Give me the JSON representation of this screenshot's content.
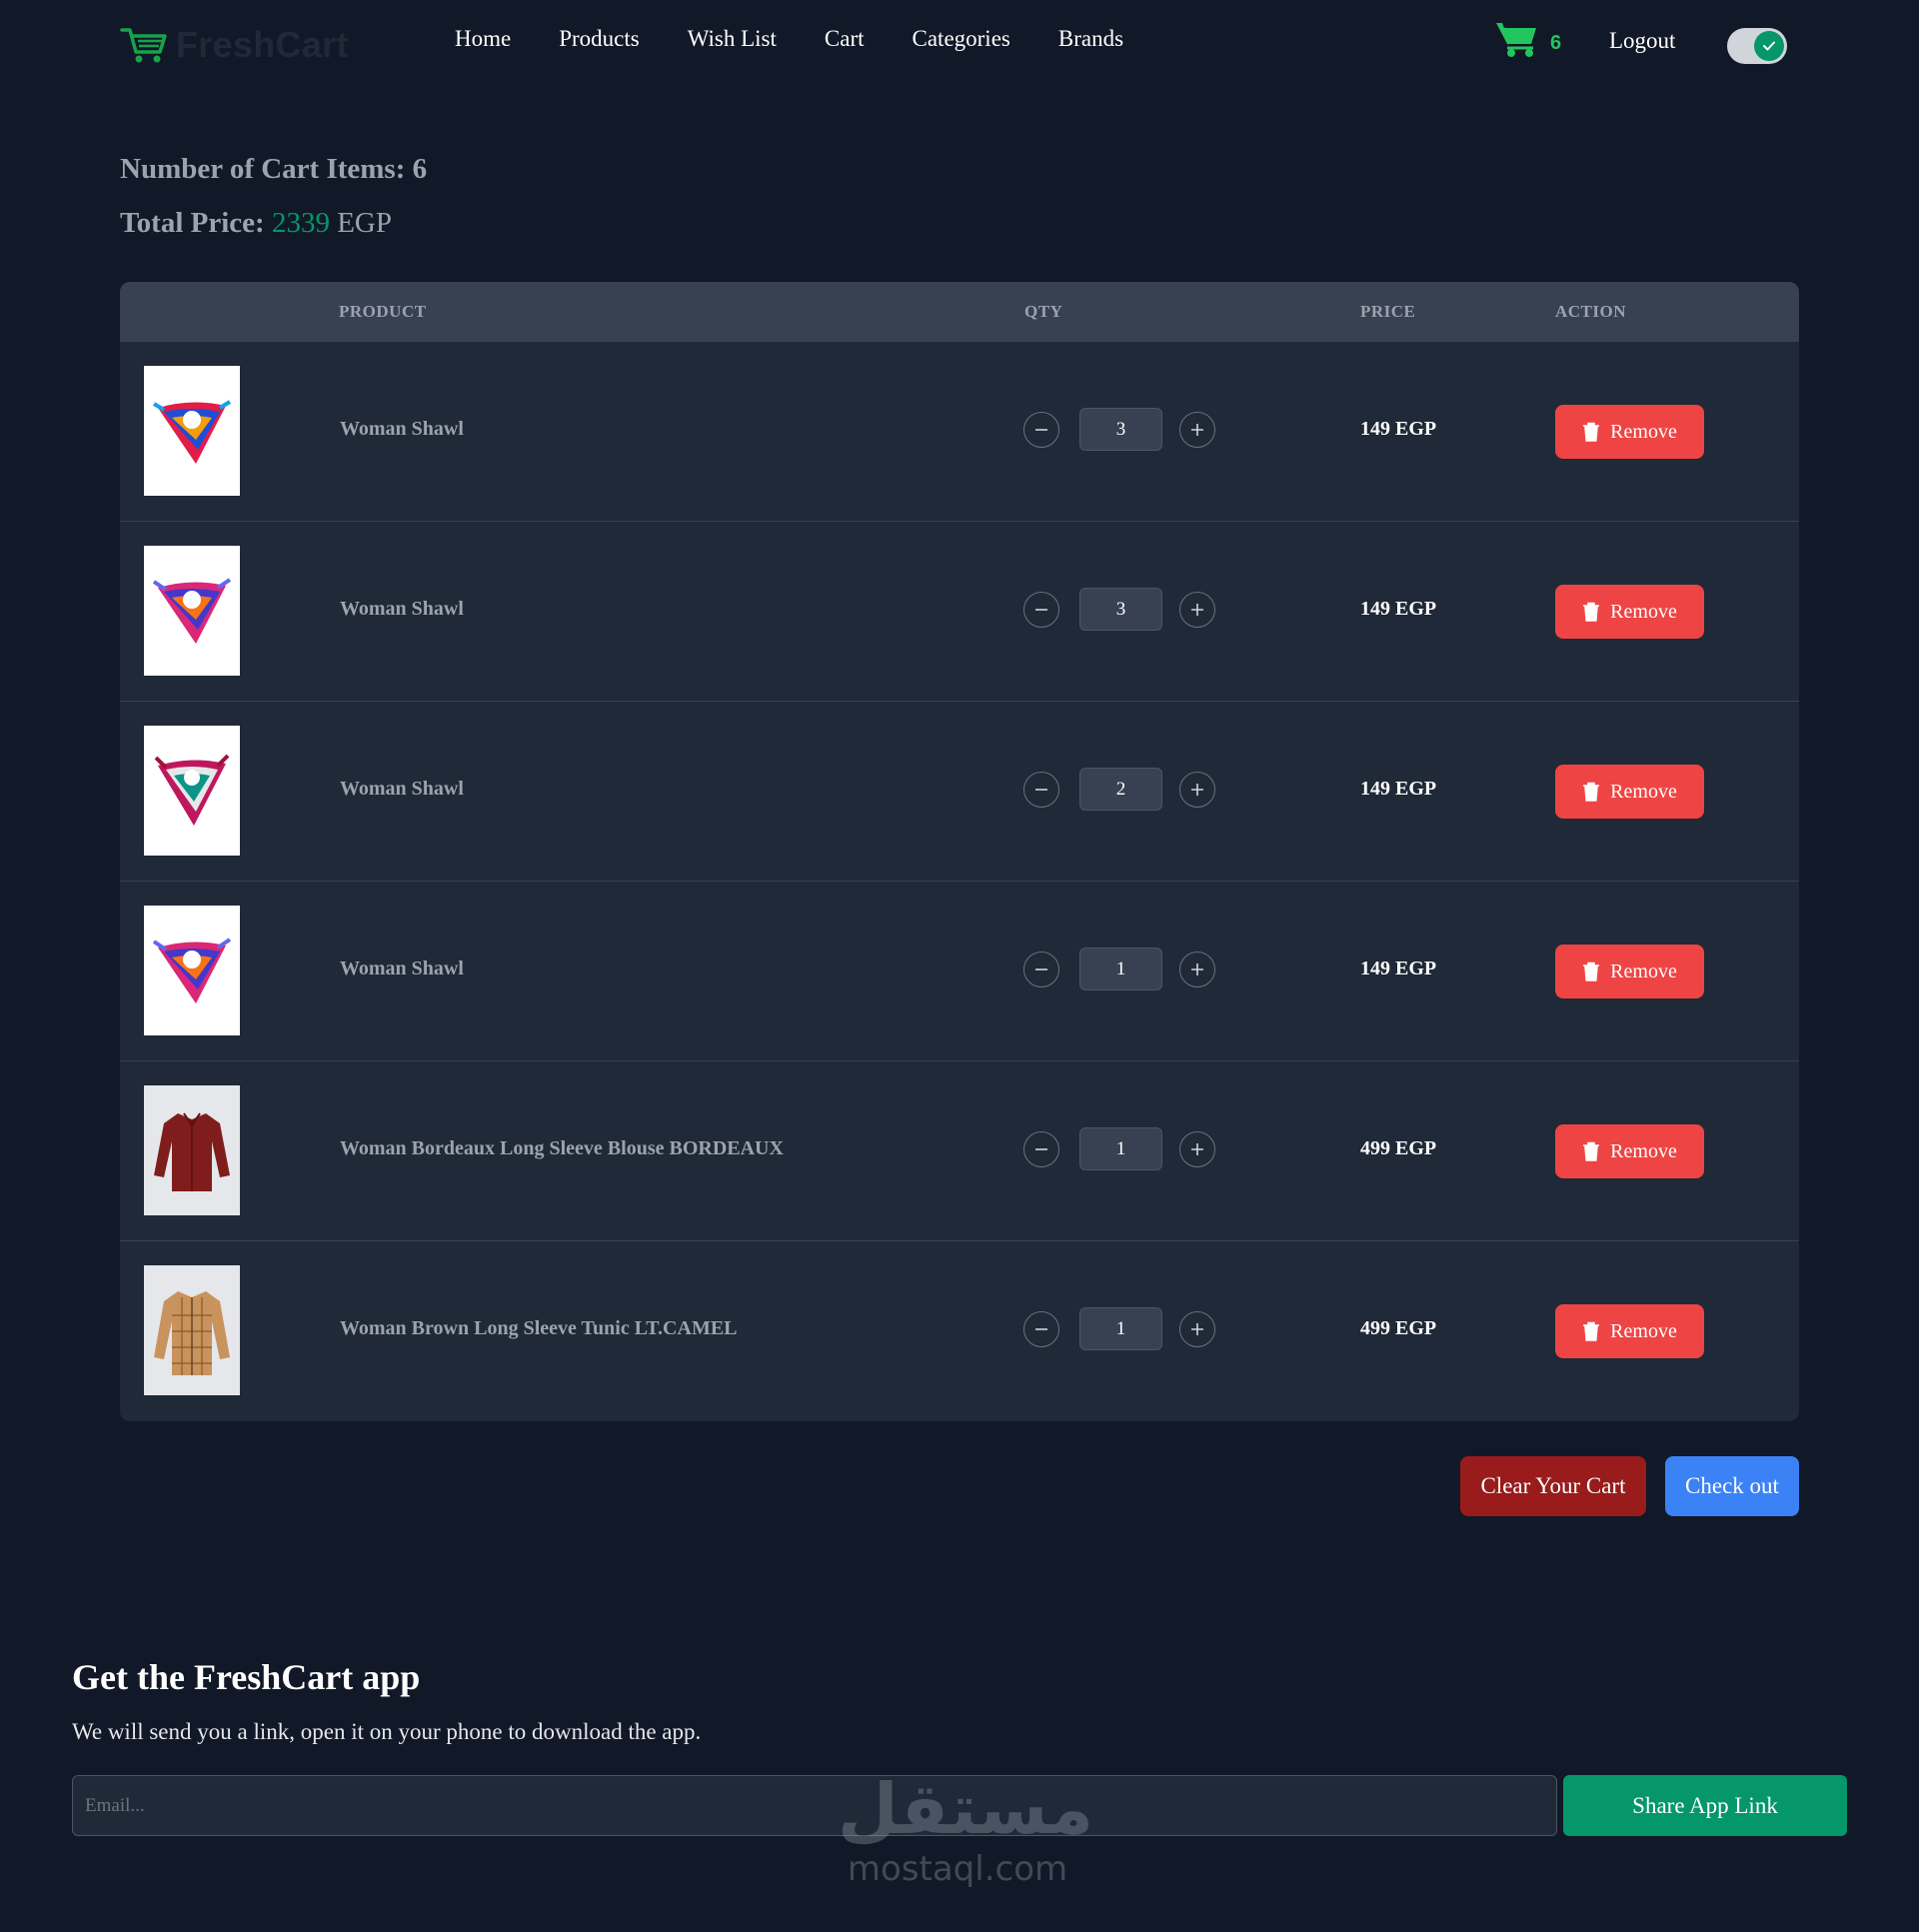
{
  "navbar": {
    "logo_text": "FreshCart",
    "links": [
      "Home",
      "Products",
      "Wish List",
      "Cart",
      "Categories",
      "Brands"
    ],
    "cart_count": "6",
    "logout_label": "Logout",
    "theme_toggle_on": true
  },
  "summary": {
    "count_label": "Number of Cart Items: 6",
    "total_label": "Total Price:",
    "total_amount": "2339",
    "total_currency": "EGP"
  },
  "table": {
    "headers": {
      "product": "PRODUCT",
      "qty": "QTY",
      "price": "PRICE",
      "action": "ACTION"
    },
    "rows": [
      {
        "name": "Woman Shawl",
        "qty": "3",
        "price": "149 EGP",
        "remove_label": "Remove",
        "image_icon": "shawl-image"
      },
      {
        "name": "Woman Shawl",
        "qty": "3",
        "price": "149 EGP",
        "remove_label": "Remove",
        "image_icon": "shawl-image"
      },
      {
        "name": "Woman Shawl",
        "qty": "2",
        "price": "149 EGP",
        "remove_label": "Remove",
        "image_icon": "shawl-image"
      },
      {
        "name": "Woman Shawl",
        "qty": "1",
        "price": "149 EGP",
        "remove_label": "Remove",
        "image_icon": "shawl-image"
      },
      {
        "name": "Woman Bordeaux Long Sleeve Blouse BORDEAUX",
        "qty": "1",
        "price": "499 EGP",
        "remove_label": "Remove",
        "image_icon": "blouse-image"
      },
      {
        "name": "Woman Brown Long Sleeve Tunic LT.CAMEL",
        "qty": "1",
        "price": "499 EGP",
        "remove_label": "Remove",
        "image_icon": "tunic-image"
      }
    ]
  },
  "actions": {
    "clear_label": "Clear Your Cart",
    "checkout_label": "Check out"
  },
  "app_section": {
    "title": "Get the FreshCart app",
    "description": "We will send you a link, open it on your phone to download the app.",
    "email_placeholder": "Email...",
    "share_label": "Share App Link"
  },
  "watermark": {
    "arabic": "مستقل",
    "latin": "mostaql.com"
  },
  "colors": {
    "background": "#111827",
    "panel": "#1f2937",
    "header_row": "#374151",
    "accent_green": "#059669",
    "remove_red": "#ef4444",
    "clear_red": "#991b1b",
    "checkout_blue": "#3b82f6"
  }
}
